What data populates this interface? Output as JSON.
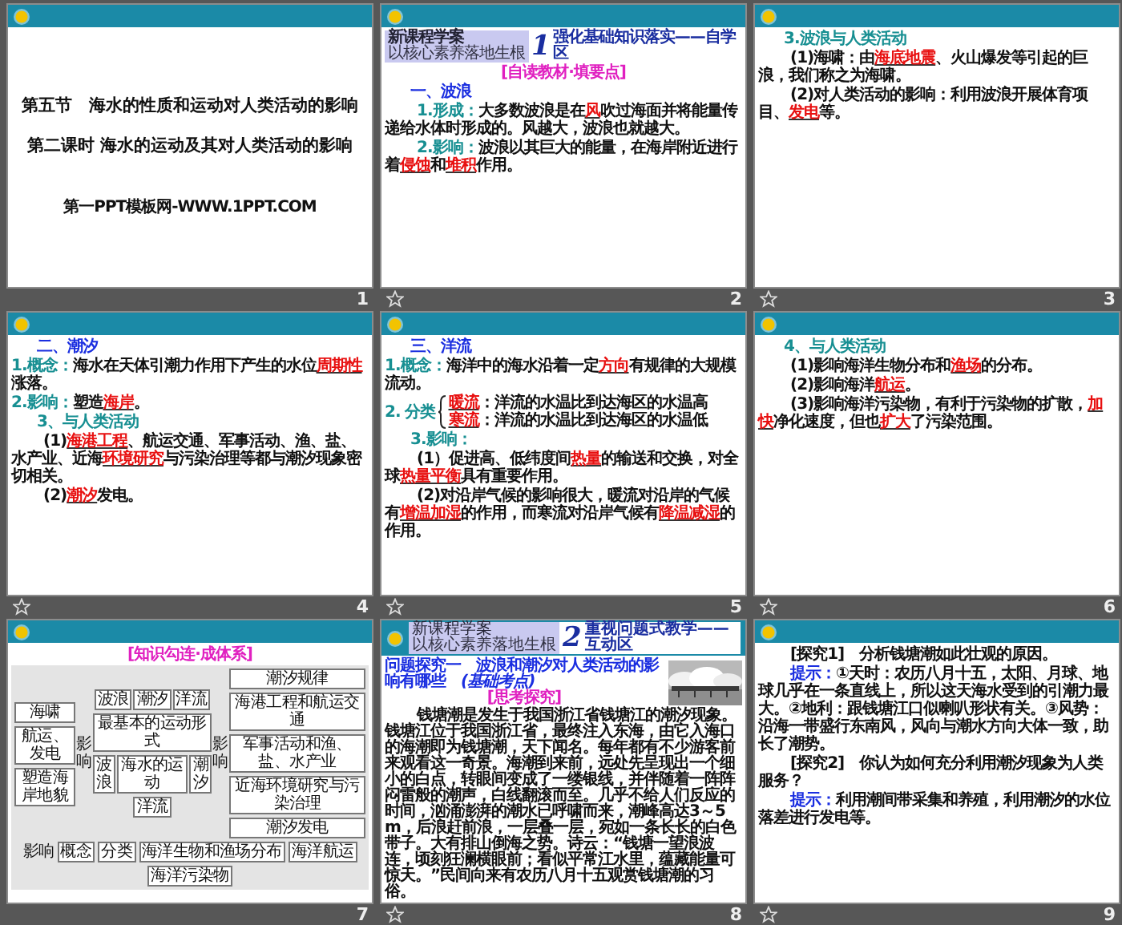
{
  "slides": [
    {
      "number": "1",
      "star": false,
      "selected": false,
      "blocks": [
        {
          "kind": "title",
          "text": "第五节　海水的性质和运动对人类活动的影响"
        },
        {
          "kind": "title",
          "text": "第二课时 海水的运动及其对人类活动的影响"
        },
        {
          "kind": "footer",
          "text": "第一PPT模板网-WWW.1PPT.COM"
        }
      ]
    },
    {
      "number": "2",
      "star": true,
      "selected": false,
      "blocks": [
        {
          "kind": "banner",
          "title": "新课程学案",
          "subtitle": "以核心素养落地生根",
          "number": "1",
          "heading": "强化基础知识落实——自学区"
        },
        {
          "kind": "subtitle",
          "text": "[自读教材·填要点]"
        },
        {
          "kind": "heading",
          "text": "一、波浪"
        },
        {
          "kind": "para",
          "indent": true,
          "parts": [
            {
              "kind": "label",
              "text": "1.形成："
            },
            {
              "kind": "text",
              "text": "大多数波浪是在"
            },
            {
              "kind": "blank",
              "text": "风"
            },
            {
              "kind": "text",
              "text": "吹过海面并将能量传递给水体时形成的。风越大，波浪也就越大。"
            }
          ]
        },
        {
          "kind": "para",
          "indent": true,
          "parts": [
            {
              "kind": "label",
              "text": "2.影响："
            },
            {
              "kind": "text",
              "text": "波浪以其巨大的能量，在海岸附近进行着"
            },
            {
              "kind": "blank",
              "text": "侵蚀"
            },
            {
              "kind": "text",
              "text": "和"
            },
            {
              "kind": "blank",
              "text": "堆积"
            },
            {
              "kind": "text",
              "text": "作用。"
            }
          ]
        }
      ]
    },
    {
      "number": "3",
      "star": true,
      "selected": false,
      "blocks": [
        {
          "kind": "section",
          "text": "3.波浪与人类活动"
        },
        {
          "kind": "para",
          "indent": true,
          "parts": [
            {
              "kind": "text",
              "text": "(1)海啸：由"
            },
            {
              "kind": "blank",
              "text": "海底地震"
            },
            {
              "kind": "text",
              "text": "、火山爆发等引起的巨浪，我们称之为海啸。"
            }
          ]
        },
        {
          "kind": "para",
          "indent": true,
          "parts": [
            {
              "kind": "text",
              "text": "(2)对人类活动的影响：利用波浪开展体育项目、"
            },
            {
              "kind": "blank",
              "text": "发电"
            },
            {
              "kind": "text",
              "text": "等。"
            }
          ]
        }
      ]
    },
    {
      "number": "4",
      "star": true,
      "selected": false,
      "blocks": [
        {
          "kind": "heading",
          "text": "二、潮汐"
        },
        {
          "kind": "para",
          "indent": false,
          "parts": [
            {
              "kind": "label",
              "text": "1.概念："
            },
            {
              "kind": "text",
              "text": "海水在天体引潮力作用下产生的水位"
            },
            {
              "kind": "blank",
              "text": "周期性"
            },
            {
              "kind": "text",
              "text": "涨落。"
            }
          ]
        },
        {
          "kind": "para",
          "indent": false,
          "parts": [
            {
              "kind": "label",
              "text": "2.影响："
            },
            {
              "kind": "text",
              "text": "塑造"
            },
            {
              "kind": "blank",
              "text": "海岸"
            },
            {
              "kind": "text",
              "text": "。"
            }
          ]
        },
        {
          "kind": "section",
          "text": "3、与人类活动"
        },
        {
          "kind": "para",
          "indent": true,
          "parts": [
            {
              "kind": "text",
              "text": "(1)"
            },
            {
              "kind": "blank",
              "text": "海港工程"
            },
            {
              "kind": "text",
              "text": "、航运交通、军事活动、渔、盐、水产业、近海"
            },
            {
              "kind": "blank",
              "text": "环境研究"
            },
            {
              "kind": "text",
              "text": "与污染治理等都与潮汐现象密切相关。"
            }
          ]
        },
        {
          "kind": "para",
          "indent": true,
          "parts": [
            {
              "kind": "text",
              "text": "(2)"
            },
            {
              "kind": "blank",
              "text": "潮汐"
            },
            {
              "kind": "text",
              "text": "发电。"
            }
          ]
        }
      ]
    },
    {
      "number": "5",
      "star": true,
      "selected": false,
      "blocks": [
        {
          "kind": "heading",
          "text": "三、洋流"
        },
        {
          "kind": "para",
          "indent": false,
          "parts": [
            {
              "kind": "label",
              "text": "1.概念："
            },
            {
              "kind": "text",
              "text": "海洋中的海水沿着一定"
            },
            {
              "kind": "blank",
              "text": "方向"
            },
            {
              "kind": "text",
              "text": "有规律的大规模流动。"
            }
          ]
        },
        {
          "kind": "brace",
          "label": "2. 分类",
          "items": [
            {
              "parts": [
                {
                  "kind": "blank",
                  "text": "暖流"
                },
                {
                  "kind": "text",
                  "text": "：洋流的水温比到达海区的水温高"
                }
              ]
            },
            {
              "parts": [
                {
                  "kind": "blank",
                  "text": "寒流"
                },
                {
                  "kind": "text",
                  "text": "：洋流的水温比到达海区的水温低"
                }
              ]
            }
          ]
        },
        {
          "kind": "section",
          "text": "3.影响："
        },
        {
          "kind": "para",
          "indent": true,
          "parts": [
            {
              "kind": "text",
              "text": "(1）促进高、低纬度间"
            },
            {
              "kind": "blank",
              "text": "热量"
            },
            {
              "kind": "text",
              "text": "的输送和交换，对全球"
            },
            {
              "kind": "blank",
              "text": "热量平衡"
            },
            {
              "kind": "text",
              "text": "具有重要作用。"
            }
          ]
        },
        {
          "kind": "para",
          "indent": true,
          "parts": [
            {
              "kind": "text",
              "text": "(2)对沿岸气候的影响很大，暖流对沿岸的气候有"
            },
            {
              "kind": "blank",
              "text": "增温加湿"
            },
            {
              "kind": "text",
              "text": "的作用，而寒流对沿岸气候有"
            },
            {
              "kind": "blank",
              "text": "降温减湿"
            },
            {
              "kind": "text",
              "text": "的作用。"
            }
          ]
        }
      ]
    },
    {
      "number": "6",
      "star": true,
      "selected": false,
      "blocks": [
        {
          "kind": "section",
          "text": "4、与人类活动"
        },
        {
          "kind": "para",
          "indent": true,
          "parts": [
            {
              "kind": "text",
              "text": "(1)影响海洋生物分布和"
            },
            {
              "kind": "blank",
              "text": "渔场"
            },
            {
              "kind": "text",
              "text": "的分布。"
            }
          ]
        },
        {
          "kind": "para",
          "indent": true,
          "parts": [
            {
              "kind": "text",
              "text": "(2)影响海洋"
            },
            {
              "kind": "blank",
              "text": "航运"
            },
            {
              "kind": "text",
              "text": "。"
            }
          ]
        },
        {
          "kind": "para",
          "indent": true,
          "parts": [
            {
              "kind": "text",
              "text": "(3)影响海洋污染物，有利于污染物的扩散，"
            },
            {
              "kind": "blank",
              "text": "加快"
            },
            {
              "kind": "text",
              "text": "净化速度，但也"
            },
            {
              "kind": "blank",
              "text": "扩大"
            },
            {
              "kind": "text",
              "text": "了污染范围。"
            }
          ]
        }
      ]
    },
    {
      "number": "7",
      "star": false,
      "selected": false,
      "blocks": [
        {
          "kind": "subtitle",
          "text": "[知识勾连·成体系]"
        },
        {
          "kind": "diagram",
          "left": [
            "海啸",
            "航运、发电",
            "塑造海岸地貌"
          ],
          "left_link": "影响",
          "top": [
            "波浪",
            "潮汐",
            "洋流"
          ],
          "core": "最基本的运动形式",
          "middle": [
            "波浪",
            "海水的运动",
            "潮汐"
          ],
          "under": "洋流",
          "right_link": "影响",
          "right": [
            "潮汐规律",
            "海港工程和航运交通",
            "军事活动和渔、盐、水产业",
            "近海环境研究与污染治理",
            "潮汐发电"
          ],
          "bottom_link": "影响",
          "bottom": [
            "概念",
            "分类",
            "海洋生物和渔场分布",
            "海洋航运",
            "海洋污染物"
          ]
        }
      ]
    },
    {
      "number": "8",
      "star": true,
      "selected": false,
      "bar_banner": {
        "title": "新课程学案",
        "subtitle": "以核心素养落地生根",
        "number": "2",
        "heading": "重视问题式教学——互动区"
      },
      "blocks": [
        {
          "kind": "question",
          "text": "问题探究一　波浪和潮汐对人类活动的影响有哪些　",
          "tag": "(基础考点)"
        },
        {
          "kind": "subtitle",
          "text": "[思考探究]"
        },
        {
          "kind": "picture"
        },
        {
          "kind": "para",
          "indent": true,
          "parts": [
            {
              "kind": "text",
              "text": "钱塘潮是发生于我国浙江省钱塘江的潮汐现象。钱塘江位于我国浙江省，最终注入东海，由它入海口的海潮即为钱塘潮，天下闻名。每年都有不少游客前来观看这一奇景。海潮到来前，远处先呈现出一个细小的白点，转眼间变成了一缕银线，并伴随着一阵阵闷雷般的潮声，白线翻滚而至。几乎不给人们反应的时间，汹涌澎湃的潮水已呼啸而来，潮峰高达3～5 m，后浪赶前浪，一层叠一层，宛如一条长长的白色带子。大有排山倒海之势。诗云：“钱塘一望浪波连，顷刻狂澜横眼前；看似平常江水里，蕴藏能量可惊天。”民间向来有农历八月十五观赏钱塘潮的习俗。"
            }
          ]
        }
      ]
    },
    {
      "number": "9",
      "star": true,
      "selected": false,
      "blocks": [
        {
          "kind": "para",
          "indent": true,
          "parts": [
            {
              "kind": "text",
              "text": "[探究1]　分析钱塘潮如此壮观的原因。"
            }
          ]
        },
        {
          "kind": "para",
          "indent": true,
          "parts": [
            {
              "kind": "hint",
              "text": "提示："
            },
            {
              "kind": "text",
              "text": "①天时：农历八月十五，太阳、月球、地球几乎在一条直线上，所以这天海水受到的引潮力最大。②地利：跟钱塘江口似喇叭形状有关。③风势：沿海一带盛行东南风，风向与潮水方向大体一致，助长了潮势。"
            }
          ]
        },
        {
          "kind": "para",
          "indent": true,
          "parts": [
            {
              "kind": "text",
              "text": "[探究2]　你认为如何充分利用潮汐现象为人类服务？"
            }
          ]
        },
        {
          "kind": "para",
          "indent": true,
          "parts": [
            {
              "kind": "hint",
              "text": "提示："
            },
            {
              "kind": "text",
              "text": "利用潮间带采集和养殖，利用潮汐的水位落差进行发电等。"
            }
          ]
        }
      ]
    }
  ]
}
